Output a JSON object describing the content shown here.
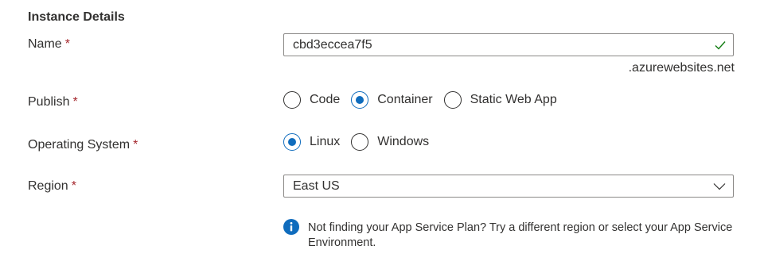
{
  "section": {
    "title": "Instance Details"
  },
  "name_field": {
    "label": "Name",
    "required_marker": "*",
    "value": "cbd3eccea7f5",
    "suffix": ".azurewebsites.net",
    "valid_icon": "checkmark-icon"
  },
  "publish": {
    "label": "Publish",
    "required_marker": "*",
    "options": [
      {
        "label": "Code",
        "selected": false
      },
      {
        "label": "Container",
        "selected": true
      },
      {
        "label": "Static Web App",
        "selected": false
      }
    ]
  },
  "os": {
    "label": "Operating System",
    "required_marker": "*",
    "options": [
      {
        "label": "Linux",
        "selected": true
      },
      {
        "label": "Windows",
        "selected": false
      }
    ]
  },
  "region": {
    "label": "Region",
    "required_marker": "*",
    "value": "East US",
    "chevron_icon": "chevron-down-icon"
  },
  "info": {
    "icon": "info-icon",
    "text": "Not finding your App Service Plan? Try a different region or select your App Service Environment."
  },
  "colors": {
    "accent": "#0f6cbd",
    "required": "#a4262c",
    "valid": "#107c10",
    "text": "#323130",
    "border": "#8a8886"
  }
}
